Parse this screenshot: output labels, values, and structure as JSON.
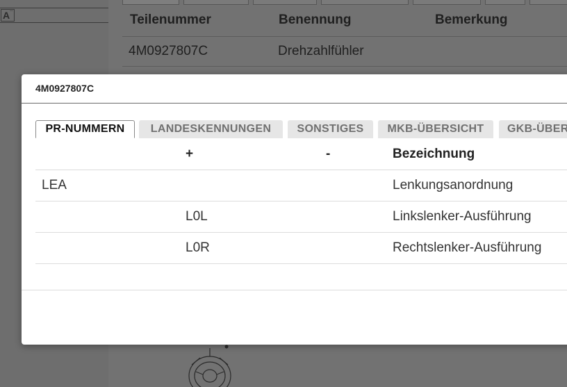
{
  "background": {
    "left_icon": "A",
    "table": {
      "headers": [
        "Teilenummer",
        "Benennung",
        "Bemerkung"
      ],
      "rows": [
        [
          "4M0927807C",
          "Drehzahlfühler",
          ""
        ]
      ]
    }
  },
  "modal": {
    "title": "4M0927807C",
    "tabs": [
      {
        "label": "PR-NUMMERN",
        "active": true
      },
      {
        "label": "LANDESKENNUNGEN",
        "active": false
      },
      {
        "label": "SONSTIGES",
        "active": false
      },
      {
        "label": "MKB-ÜBERSICHT",
        "active": false
      },
      {
        "label": "GKB-ÜBERSICHT",
        "active": false
      }
    ],
    "table": {
      "headers": [
        "",
        "+",
        "-",
        "Bezeichnung"
      ],
      "rows": [
        [
          "LEA",
          "",
          "",
          "Lenkungsanordnung"
        ],
        [
          "",
          "L0L",
          "",
          "Linkslenker-Ausführung"
        ],
        [
          "",
          "L0R",
          "",
          "Rechtslenker-Ausführung"
        ]
      ]
    }
  }
}
